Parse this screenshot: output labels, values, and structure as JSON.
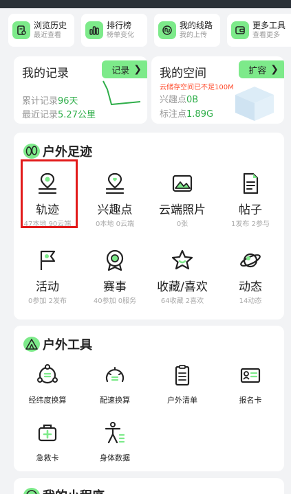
{
  "quick_links": [
    {
      "title": "浏览历史",
      "sub": "最近查看",
      "icon": "history-icon"
    },
    {
      "title": "排行榜",
      "sub": "榜单变化",
      "icon": "ranking-icon"
    },
    {
      "title": "我的线路",
      "sub": "我的上传",
      "icon": "route-icon"
    },
    {
      "title": "更多工具",
      "sub": "查看更多",
      "icon": "wallet-icon"
    }
  ],
  "records": {
    "title": "我的记录",
    "button": "记录",
    "line1_prefix": "累计记录",
    "line1_value": "96天",
    "line2_prefix": "最近记录",
    "line2_value": "5.27公里"
  },
  "space": {
    "title": "我的空间",
    "button": "扩容",
    "warning": "云储存空间已不足100M",
    "line1_prefix": "兴趣点",
    "line1_value": "0B",
    "line2_prefix": "标注点",
    "line2_value": "1.89G"
  },
  "outdoor": {
    "title": "户外足迹",
    "items": [
      {
        "label": "轨迹",
        "sub": "47本地 90云端",
        "icon": "track-pin-icon"
      },
      {
        "label": "兴趣点",
        "sub": "0本地 0云端",
        "icon": "poi-heart-icon"
      },
      {
        "label": "云端照片",
        "sub": "0张",
        "icon": "photo-icon"
      },
      {
        "label": "帖子",
        "sub": "1发布 2参与",
        "icon": "document-icon"
      },
      {
        "label": "活动",
        "sub": "0参加 2发布",
        "icon": "flag-icon"
      },
      {
        "label": "赛事",
        "sub": "40参加 0服务",
        "icon": "medal-icon"
      },
      {
        "label": "收藏/喜欢",
        "sub": "64收藏 2喜欢",
        "icon": "star-icon"
      },
      {
        "label": "动态",
        "sub": "14动态",
        "icon": "planet-icon"
      }
    ]
  },
  "tools": {
    "title": "户外工具",
    "items": [
      {
        "label": "经纬度换算",
        "icon": "coordinate-convert-icon"
      },
      {
        "label": "配速换算",
        "icon": "speedometer-icon"
      },
      {
        "label": "户外清单",
        "icon": "checklist-icon"
      },
      {
        "label": "报名卡",
        "icon": "id-card-icon"
      },
      {
        "label": "急救卡",
        "icon": "first-aid-icon"
      },
      {
        "label": "身体数据",
        "icon": "body-data-icon"
      }
    ]
  },
  "mini_programs": {
    "title": "我的小程序"
  },
  "colors": {
    "accent": "#7dea8a",
    "highlight_value": "#2fae4a",
    "warning": "#ff4d2e",
    "selection_box": "#e21a1a"
  }
}
